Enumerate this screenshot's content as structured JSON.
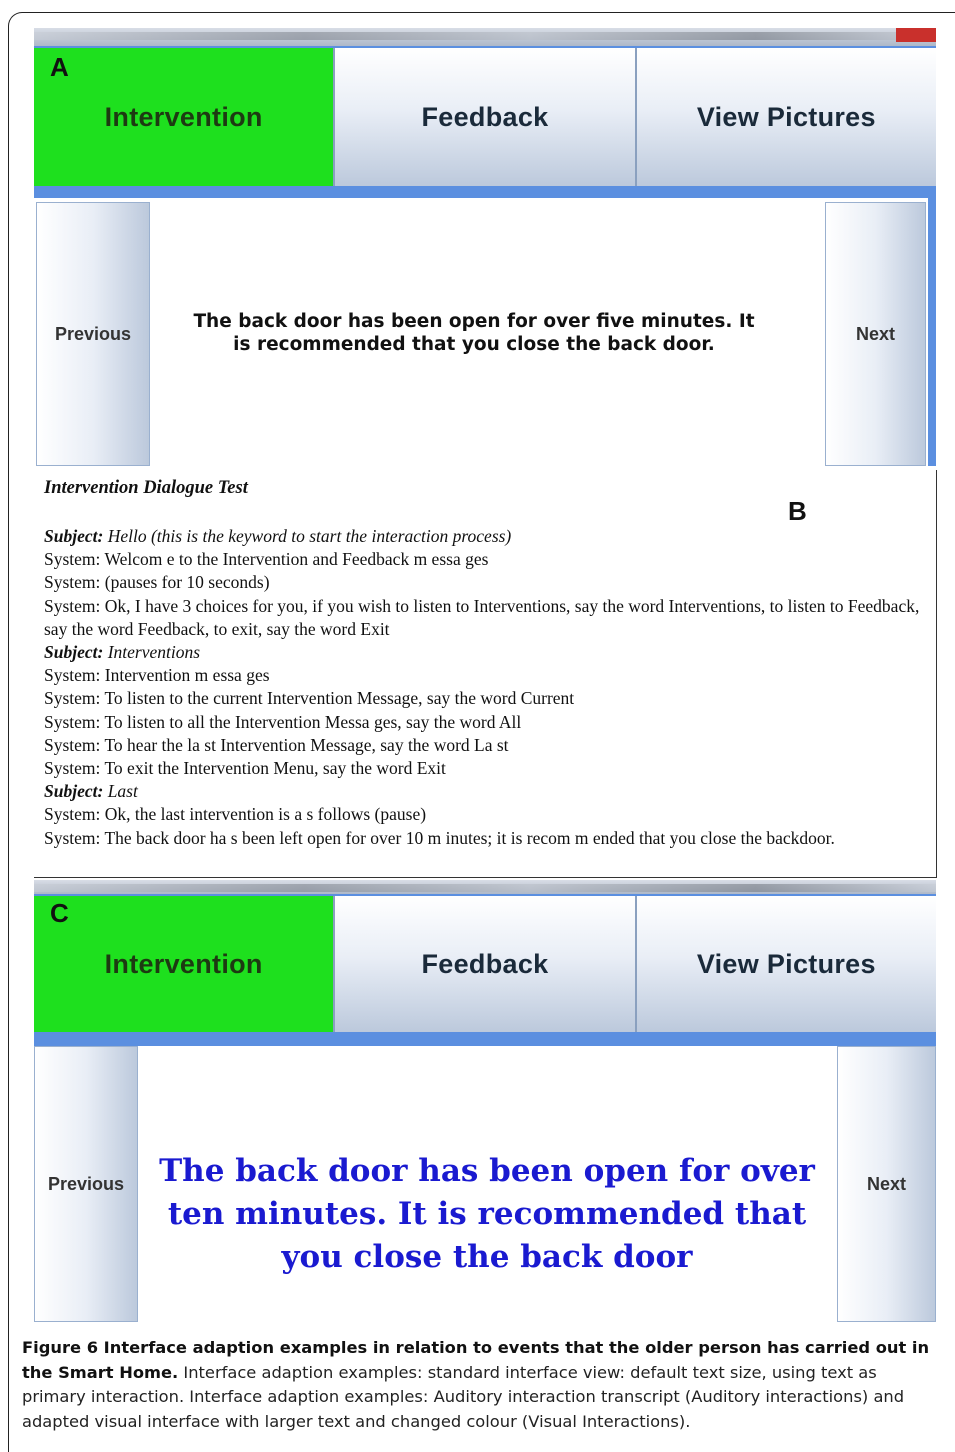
{
  "panelA": {
    "letter": "A",
    "tabs": [
      "Intervention",
      "Feedback",
      "View Pictures"
    ],
    "previous": "Previous",
    "next": "Next",
    "message": "The back door has been open for over five minutes. It is recommended that you close the back door."
  },
  "panelB": {
    "letter": "B",
    "title": "Intervention Dialogue Test",
    "lines": [
      {
        "speaker": "Subject:",
        "text": "Hello (this is the keyword to start the interaction process)"
      },
      {
        "speaker": "System",
        "text": ": Welcom e to the Intervention and Feedback m essa ges"
      },
      {
        "speaker": "System",
        "text": ": (pauses for 10 seconds)"
      },
      {
        "speaker": "System",
        "text": ": Ok, I have 3 choices for you, if you wish to listen to Interventions, say the word Interventions, to listen to Feedback, say the word Feedback, to exit, say the word Exit"
      },
      {
        "speaker": "Subject:",
        "text": "Interventions"
      },
      {
        "speaker": "System",
        "text": ": Intervention m essa ges"
      },
      {
        "speaker": "System",
        "text": ": To listen to the current Intervention Message, say the word Current"
      },
      {
        "speaker": "System",
        "text": ": To listen to all the Intervention Messa ges, say the word All"
      },
      {
        "speaker": "System",
        "text": ": To hear the la st Intervention Message, say the word La st"
      },
      {
        "speaker": "System",
        "text": ": To exit the Intervention Menu, say the word Exit"
      },
      {
        "speaker": "Subject:",
        "text": "Last"
      },
      {
        "speaker": "System",
        "text": ": Ok, the last intervention is a s follows (pause)"
      },
      {
        "speaker": "System",
        "text": ": The back door ha s been left open for over 10 m inutes; it is recom m ended that you close the backdoor."
      }
    ]
  },
  "panelC": {
    "letter": "C",
    "tabs": [
      "Intervention",
      "Feedback",
      "View Pictures"
    ],
    "previous": "Previous",
    "next": "Next",
    "message": "The back door has been open for over ten minutes. It is recommended that you close the back door"
  },
  "caption": {
    "bold": "Figure 6 Interface adaption examples in relation to events that the older person has carried out in the Smart Home.",
    "text": " Interface adaption examples: standard interface view: default text size, using text as primary interaction. Interface adaption examples: Auditory interaction transcript (Auditory interactions) and adapted visual interface with larger text and changed colour (Visual Interactions)."
  },
  "colors": {
    "active_tab": "#1ee01e",
    "frame_blue": "#5b8fe0",
    "large_text": "#1a1ad0"
  }
}
